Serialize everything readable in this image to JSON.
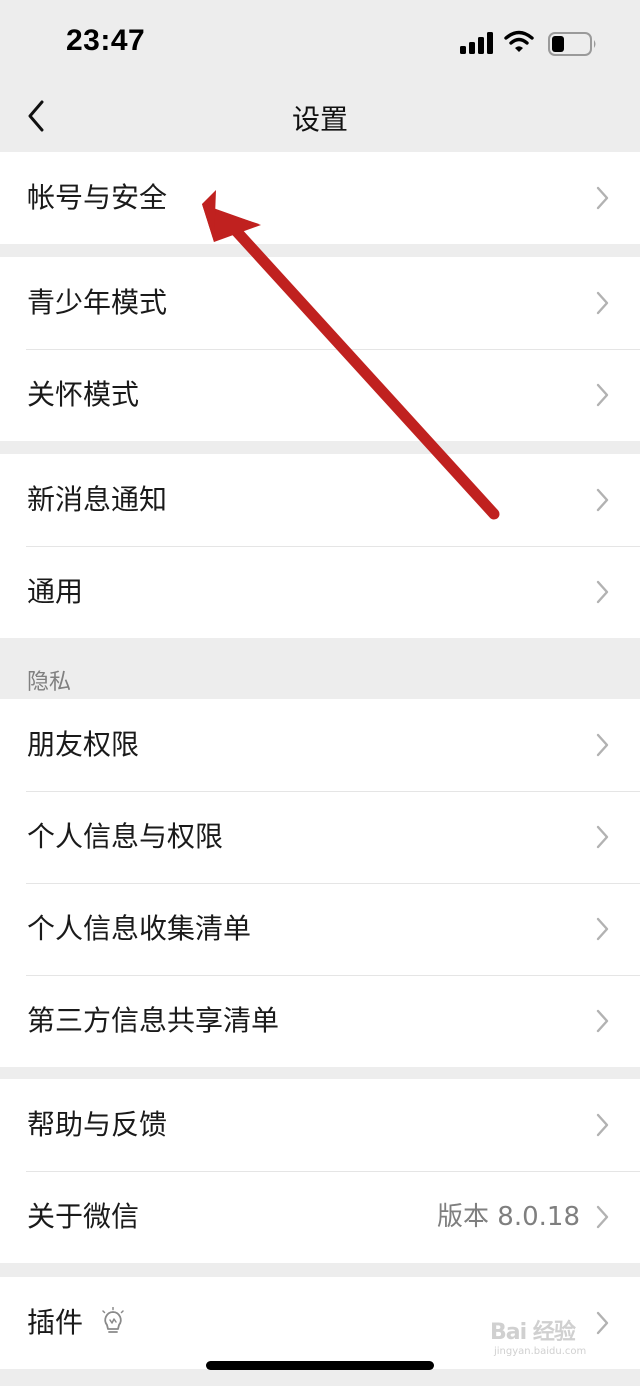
{
  "status_bar": {
    "time": "23:47"
  },
  "nav": {
    "title": "设置"
  },
  "groups": [
    {
      "items": [
        {
          "label": "帐号与安全"
        }
      ]
    },
    {
      "items": [
        {
          "label": "青少年模式"
        },
        {
          "label": "关怀模式"
        }
      ]
    },
    {
      "items": [
        {
          "label": "新消息通知"
        },
        {
          "label": "通用"
        }
      ]
    },
    {
      "header": "隐私",
      "items": [
        {
          "label": "朋友权限"
        },
        {
          "label": "个人信息与权限"
        },
        {
          "label": "个人信息收集清单"
        },
        {
          "label": "第三方信息共享清单"
        }
      ]
    },
    {
      "items": [
        {
          "label": "帮助与反馈"
        },
        {
          "label": "关于微信",
          "value": "版本 8.0.18"
        }
      ]
    },
    {
      "items": [
        {
          "label": "插件",
          "icon": "lightbulb-icon"
        }
      ]
    }
  ],
  "annotation": {
    "arrow_color": "#c0211f",
    "points_to": "帐号与安全"
  },
  "watermark": {
    "text": "Bai 经验",
    "sub": "jingyan.baidu.com"
  },
  "colors": {
    "background": "#ededed",
    "cell": "#ffffff",
    "chevron": "#b2b2b2",
    "secondary_text": "#7f7f7f"
  }
}
